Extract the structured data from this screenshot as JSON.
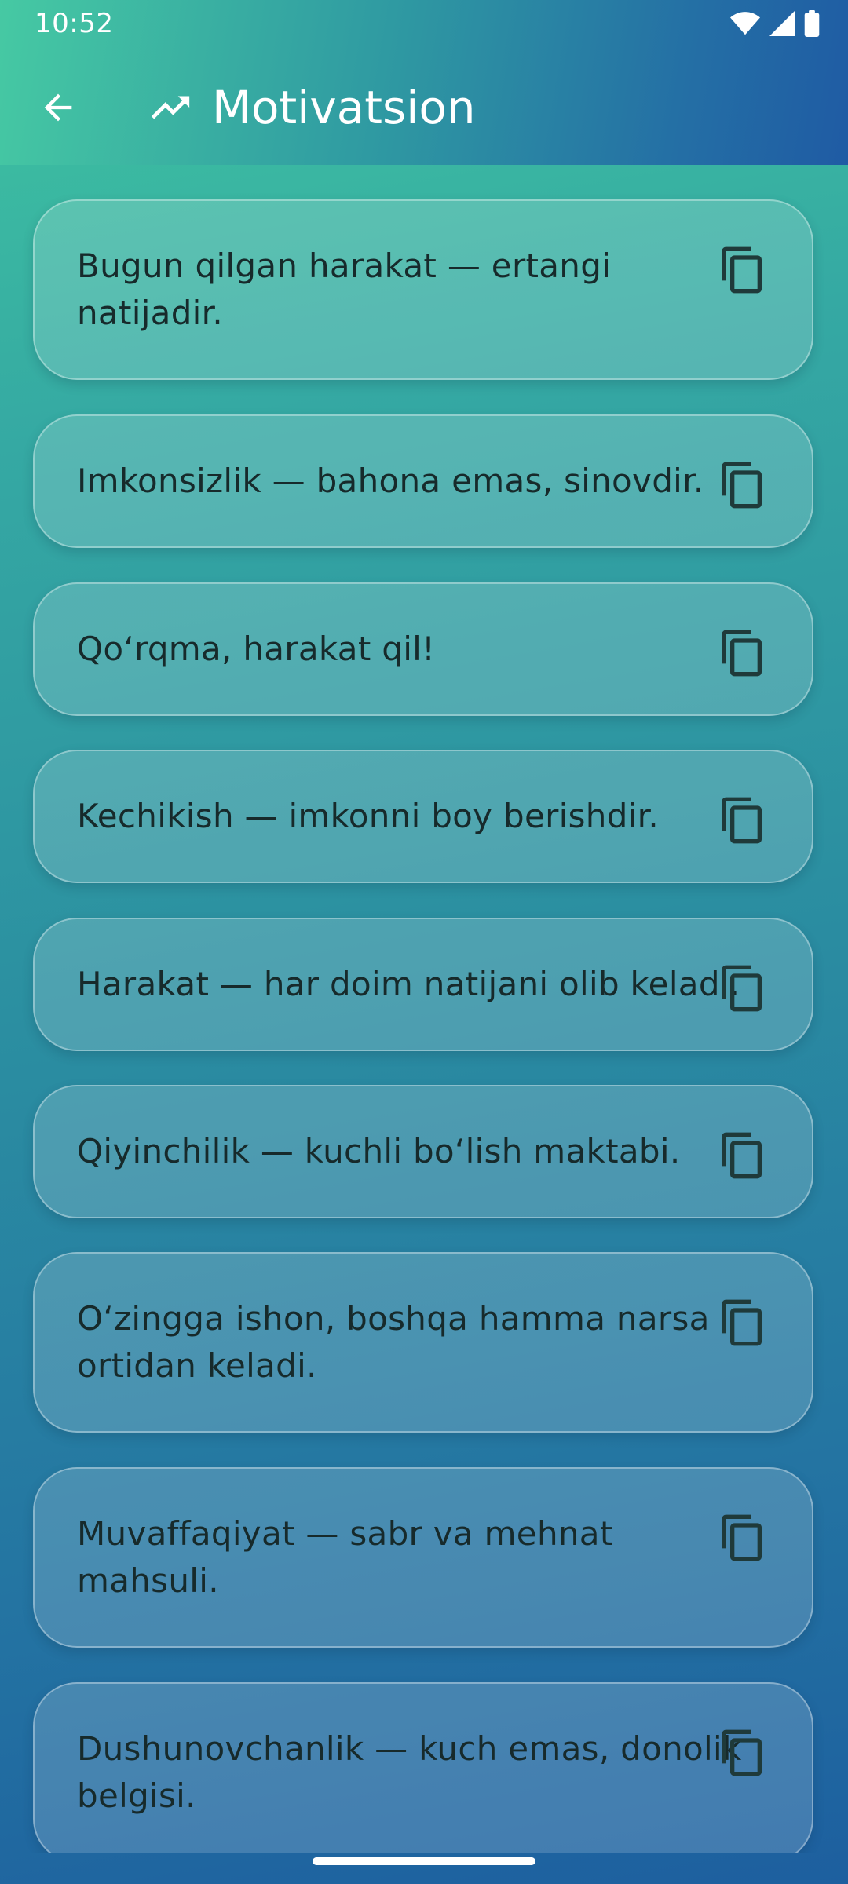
{
  "status_bar": {
    "time": "10:52",
    "icons": [
      "wifi-icon",
      "signal-icon",
      "battery-icon"
    ]
  },
  "app_bar": {
    "back_icon": "arrow-back-icon",
    "title_icon": "trending-up-icon",
    "title": "Motivatsion"
  },
  "quotes": [
    {
      "text": "Bugun qilgan harakat — ertangi natijadir.",
      "icon": "copy-icon"
    },
    {
      "text": "Imkonsizlik — bahona emas, sinovdir.",
      "icon": "copy-icon"
    },
    {
      "text": "Qo‘rqma, harakat qil!",
      "icon": "copy-icon"
    },
    {
      "text": "Kechikish — imkonni boy berishdir.",
      "icon": "copy-icon"
    },
    {
      "text": "Harakat — har doim natijani olib keladi.",
      "icon": "copy-icon"
    },
    {
      "text": "Qiyinchilik — kuchli bo‘lish maktabi.",
      "icon": "copy-icon"
    },
    {
      "text": "O‘zingga ishon, boshqa hamma narsa ortidan keladi.",
      "icon": "copy-icon"
    },
    {
      "text": "Muvaffaqiyat — sabr va mehnat mahsuli.",
      "icon": "copy-icon"
    },
    {
      "text": "Dushunovchanlik — kuch emas, donolik belgisi.",
      "icon": "copy-icon"
    }
  ],
  "colors": {
    "gradient_top": "#46c9a3",
    "gradient_bottom": "#1d5f9f",
    "text_dark": "#172a2b",
    "white": "#ffffff"
  }
}
